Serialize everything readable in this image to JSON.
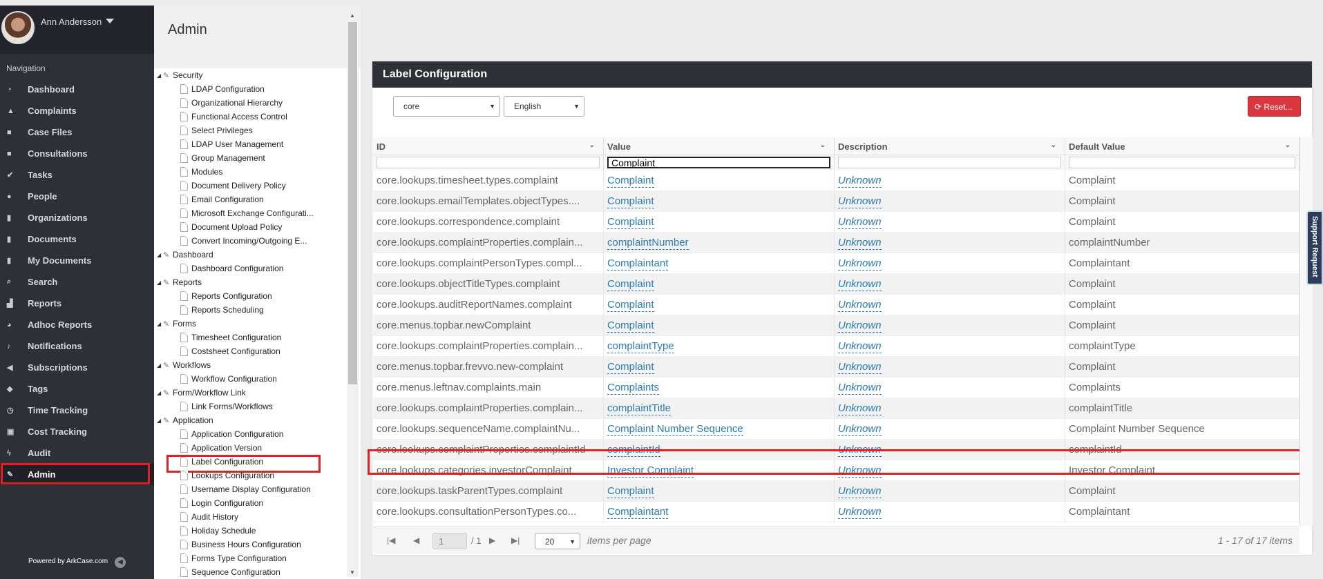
{
  "user": {
    "name": "Ann Andersson"
  },
  "sidebar": {
    "heading": "Navigation",
    "items": [
      {
        "label": "Dashboard",
        "icon": "dashboard-icon",
        "glyph": "◔"
      },
      {
        "label": "Complaints",
        "icon": "warning-icon",
        "glyph": "▲"
      },
      {
        "label": "Case Files",
        "icon": "folder-icon",
        "glyph": "■"
      },
      {
        "label": "Consultations",
        "icon": "folder-icon",
        "glyph": "■"
      },
      {
        "label": "Tasks",
        "icon": "check-circle-icon",
        "glyph": "✔"
      },
      {
        "label": "People",
        "icon": "person-icon",
        "glyph": "●"
      },
      {
        "label": "Organizations",
        "icon": "building-icon",
        "glyph": "▮"
      },
      {
        "label": "Documents",
        "icon": "document-icon",
        "glyph": "▮"
      },
      {
        "label": "My Documents",
        "icon": "document-icon",
        "glyph": "▮"
      },
      {
        "label": "Search",
        "icon": "search-icon",
        "glyph": "⌕"
      },
      {
        "label": "Reports",
        "icon": "bar-chart-icon",
        "glyph": "▟"
      },
      {
        "label": "Adhoc Reports",
        "icon": "pie-chart-icon",
        "glyph": "◕"
      },
      {
        "label": "Notifications",
        "icon": "bell-icon",
        "glyph": "♪"
      },
      {
        "label": "Subscriptions",
        "icon": "megaphone-icon",
        "glyph": "◀"
      },
      {
        "label": "Tags",
        "icon": "tag-icon",
        "glyph": "◆"
      },
      {
        "label": "Time Tracking",
        "icon": "clock-icon",
        "glyph": "◷"
      },
      {
        "label": "Cost Tracking",
        "icon": "money-icon",
        "glyph": "▣"
      },
      {
        "label": "Audit",
        "icon": "bolt-icon",
        "glyph": "ϟ"
      },
      {
        "label": "Admin",
        "icon": "wrench-icon",
        "glyph": "✎"
      }
    ],
    "powered_by": "Powered by ArkCase.com"
  },
  "admin": {
    "title": "Admin",
    "tree": [
      {
        "group": "Security",
        "items": [
          "LDAP Configuration",
          "Organizational Hierarchy",
          "Functional Access Control",
          "Select Privileges",
          "LDAP User Management",
          "Group Management",
          "Modules",
          "Document Delivery Policy",
          "Email Configuration",
          "Microsoft Exchange Configurati...",
          "Document Upload Policy",
          "Convert Incoming/Outgoing E..."
        ]
      },
      {
        "group": "Dashboard",
        "items": [
          "Dashboard Configuration"
        ]
      },
      {
        "group": "Reports",
        "items": [
          "Reports Configuration",
          "Reports Scheduling"
        ]
      },
      {
        "group": "Forms",
        "items": [
          "Timesheet Configuration",
          "Costsheet Configuration"
        ]
      },
      {
        "group": "Workflows",
        "items": [
          "Workflow Configuration"
        ]
      },
      {
        "group": "Form/Workflow Link",
        "items": [
          "Link Forms/Workflows"
        ]
      },
      {
        "group": "Application",
        "items": [
          "Application Configuration",
          "Application Version",
          "Label Configuration",
          "Lookups Configuration",
          "Username Display Configuration",
          "Login Configuration",
          "Audit History",
          "Holiday Schedule",
          "Business Hours Configuration",
          "Forms Type Configuration",
          "Sequence Configuration"
        ]
      }
    ]
  },
  "label_config": {
    "title": "Label Configuration",
    "module_select": "core",
    "language_select": "English",
    "reset_label": "Reset...",
    "columns": [
      "ID",
      "Value",
      "Description",
      "Default Value"
    ],
    "filter_value": "Complaint",
    "rows": [
      {
        "id": "core.lookups.timesheet.types.complaint",
        "value": "Complaint",
        "description": "Unknown",
        "default": "Complaint"
      },
      {
        "id": "core.lookups.emailTemplates.objectTypes....",
        "value": "Complaint",
        "description": "Unknown",
        "default": "Complaint"
      },
      {
        "id": "core.lookups.correspondence.complaint",
        "value": "Complaint",
        "description": "Unknown",
        "default": "Complaint"
      },
      {
        "id": "core.lookups.complaintProperties.complain...",
        "value": "complaintNumber",
        "description": "Unknown",
        "default": "complaintNumber"
      },
      {
        "id": "core.lookups.complaintPersonTypes.compl...",
        "value": "Complaintant",
        "description": "Unknown",
        "default": "Complaintant"
      },
      {
        "id": "core.lookups.objectTitleTypes.complaint",
        "value": "Complaint",
        "description": "Unknown",
        "default": "Complaint"
      },
      {
        "id": "core.lookups.auditReportNames.complaint",
        "value": "Complaint",
        "description": "Unknown",
        "default": "Complaint"
      },
      {
        "id": "core.menus.topbar.newComplaint",
        "value": "Complaint",
        "description": "Unknown",
        "default": "Complaint"
      },
      {
        "id": "core.lookups.complaintProperties.complain...",
        "value": "complaintType",
        "description": "Unknown",
        "default": "complaintType"
      },
      {
        "id": "core.menus.topbar.frevvo.new-complaint",
        "value": "Complaint",
        "description": "Unknown",
        "default": "Complaint"
      },
      {
        "id": "core.menus.leftnav.complaints.main",
        "value": "Complaints",
        "description": "Unknown",
        "default": "Complaints"
      },
      {
        "id": "core.lookups.complaintProperties.complain...",
        "value": "complaintTitle",
        "description": "Unknown",
        "default": "complaintTitle"
      },
      {
        "id": "core.lookups.sequenceName.complaintNu...",
        "value": "Complaint Number Sequence",
        "description": "Unknown",
        "default": "Complaint Number Sequence"
      },
      {
        "id": "core.lookups.complaintProperties.complaintId",
        "value": "complaintId",
        "description": "Unknown",
        "default": "complaintId"
      },
      {
        "id": "core.lookups.categories.investorComplaint",
        "value": "Investor Complaint",
        "description": "Unknown",
        "default": "Investor Complaint"
      },
      {
        "id": "core.lookups.taskParentTypes.complaint",
        "value": "Complaint",
        "description": "Unknown",
        "default": "Complaint"
      },
      {
        "id": "core.lookups.consultationPersonTypes.co...",
        "value": "Complaintant",
        "description": "Unknown",
        "default": "Complaintant"
      }
    ],
    "pager": {
      "page": "1",
      "of_pages": "/ 1",
      "page_size": "20",
      "items_per_page": "items per page",
      "info": "1 - 17 of 17 items"
    }
  },
  "support_label": "Support Request",
  "colors": {
    "highlight": "#e11f26",
    "link": "#2a7ab0",
    "sidebar": "#2d3037",
    "reset": "#d9363e"
  }
}
